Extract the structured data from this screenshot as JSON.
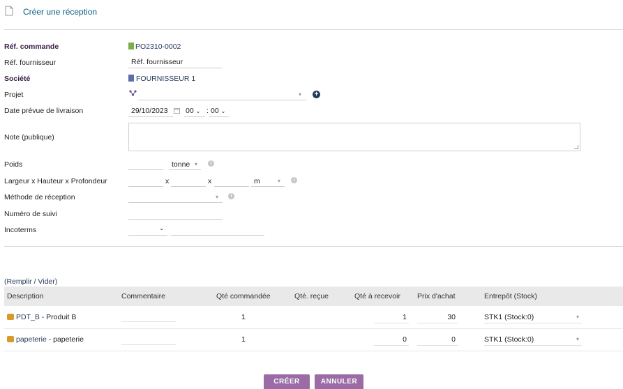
{
  "header": {
    "title": "Créer une réception",
    "icon": "document-icon"
  },
  "form": {
    "ref_commande": {
      "label": "Réf. commande",
      "value": "PO2310-0002"
    },
    "ref_fournisseur": {
      "label": "Réf. fournisseur",
      "value": "Réf. fournisseur"
    },
    "societe": {
      "label": "Société",
      "value": "FOURNISSEUR 1"
    },
    "projet": {
      "label": "Projet",
      "value": ""
    },
    "date_livraison": {
      "label": "Date prévue de livraison",
      "date": "29/10/2023",
      "hour": "00",
      "minute": "00",
      "separator": ":"
    },
    "note": {
      "label": "Note (publique)",
      "value": ""
    },
    "poids": {
      "label": "Poids",
      "unit": "tonne"
    },
    "dimensions": {
      "label": "Largeur x Hauteur x Profondeur",
      "sep1": "x",
      "sep2": "x",
      "unit": "m"
    },
    "methode": {
      "label": "Méthode de réception"
    },
    "suivi": {
      "label": "Numéro de suivi"
    },
    "incoterms": {
      "label": "Incoterms"
    }
  },
  "lines": {
    "fill_link": "(Remplir / Vider)",
    "headers": [
      "Description",
      "Commentaire",
      "Qté commandée",
      "Qté. reçue",
      "Qté à recevoir",
      "Prix d'achat",
      "Entrepôt (Stock)"
    ],
    "rows": [
      {
        "ref": "PDT_B",
        "label": " - Produit B",
        "qty_ordered": "1",
        "qty_received": "",
        "qty_to_receive": "1",
        "price": "30",
        "warehouse": "STK1 (Stock:0)"
      },
      {
        "ref": "papeterie",
        "label": " - papeterie",
        "qty_ordered": "1",
        "qty_received": "",
        "qty_to_receive": "0",
        "price": "0",
        "warehouse": "STK1 (Stock:0)"
      }
    ]
  },
  "buttons": {
    "create": "CRÉER",
    "cancel": "ANNULER"
  },
  "colors": {
    "accent": "#9a6ba5",
    "title": "#0a5d82",
    "label_bold": "#3a1d45",
    "link": "#263c5c"
  }
}
